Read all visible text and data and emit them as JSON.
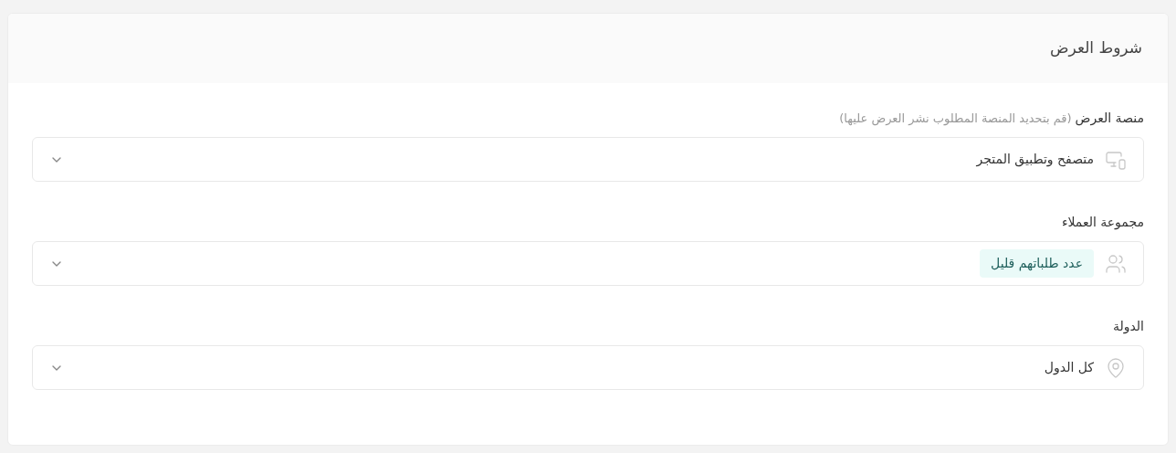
{
  "card": {
    "title": "شروط العرض"
  },
  "fields": [
    {
      "label": "منصة العرض",
      "hint": "(قم بتحديد المنصة المطلوب نشر العرض عليها)",
      "kind": "text",
      "value": "متصفح وتطبيق المتجر"
    },
    {
      "label": "مجموعة العملاء",
      "kind": "tag",
      "value": "عدد طلباتهم قليل"
    },
    {
      "label": "الدولة",
      "kind": "text",
      "value": "كل الدول"
    }
  ]
}
